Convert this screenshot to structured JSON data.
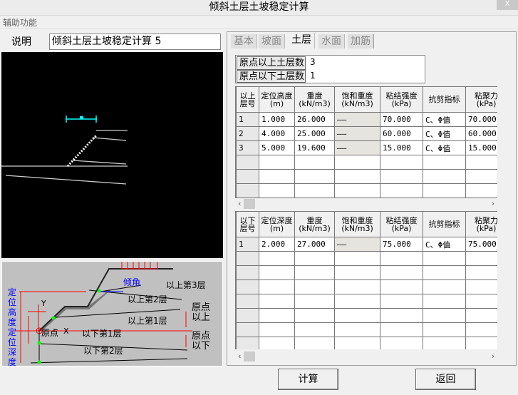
{
  "window": {
    "title": "倾斜土层土坡稳定计算",
    "close": "X"
  },
  "menu": {
    "label": "辅助功能"
  },
  "description": {
    "label": "说明",
    "value": "倾斜土层土坡稳定计算 5"
  },
  "tabs": [
    "基本",
    "坡面",
    "土层",
    "水面",
    "加筋"
  ],
  "active_tab": "土层",
  "counts": {
    "above_label": "原点以上土层数",
    "above_value": "3",
    "below_label": "原点以下土层数",
    "below_value": "1"
  },
  "upper_table": {
    "headers": [
      "以上层号",
      "定位高度(m)",
      "重度(kN/m3)",
      "饱和重度(kN/m3)",
      "粘结强度(kPa)",
      "抗剪指标",
      "粘聚力(kPa)"
    ],
    "rows": [
      [
        "1",
        "1.000",
        "26.000",
        "——",
        "70.000",
        "C、Φ值",
        "70.000"
      ],
      [
        "2",
        "4.000",
        "25.000",
        "——",
        "60.000",
        "C、Φ值",
        "60.000"
      ],
      [
        "3",
        "5.000",
        "19.600",
        "——",
        "15.000",
        "C、Φ值",
        "15.000"
      ]
    ]
  },
  "lower_table": {
    "headers": [
      "以下层号",
      "定位深度(m)",
      "重度(kN/m3)",
      "饱和重度(kN/m3)",
      "粘结强度(kPa)",
      "抗剪指标",
      "粘聚力(kPa)"
    ],
    "rows": [
      [
        "1",
        "2.000",
        "27.000",
        "——",
        "75.000",
        "C、Φ值",
        "75.000"
      ]
    ]
  },
  "diagram": {
    "labels": {
      "angle": "倾角",
      "a3": "以上第3层",
      "a2": "以上第2层",
      "a1": "以上第1层",
      "origin": "原点",
      "x": "X",
      "y": "Y",
      "b1": "以下第1层",
      "b2": "以下第2层",
      "above": "原点以上",
      "below": "原点以下",
      "height": "定位高度",
      "depth": "定位深度"
    }
  },
  "buttons": {
    "calc": "计算",
    "back": "返回"
  }
}
